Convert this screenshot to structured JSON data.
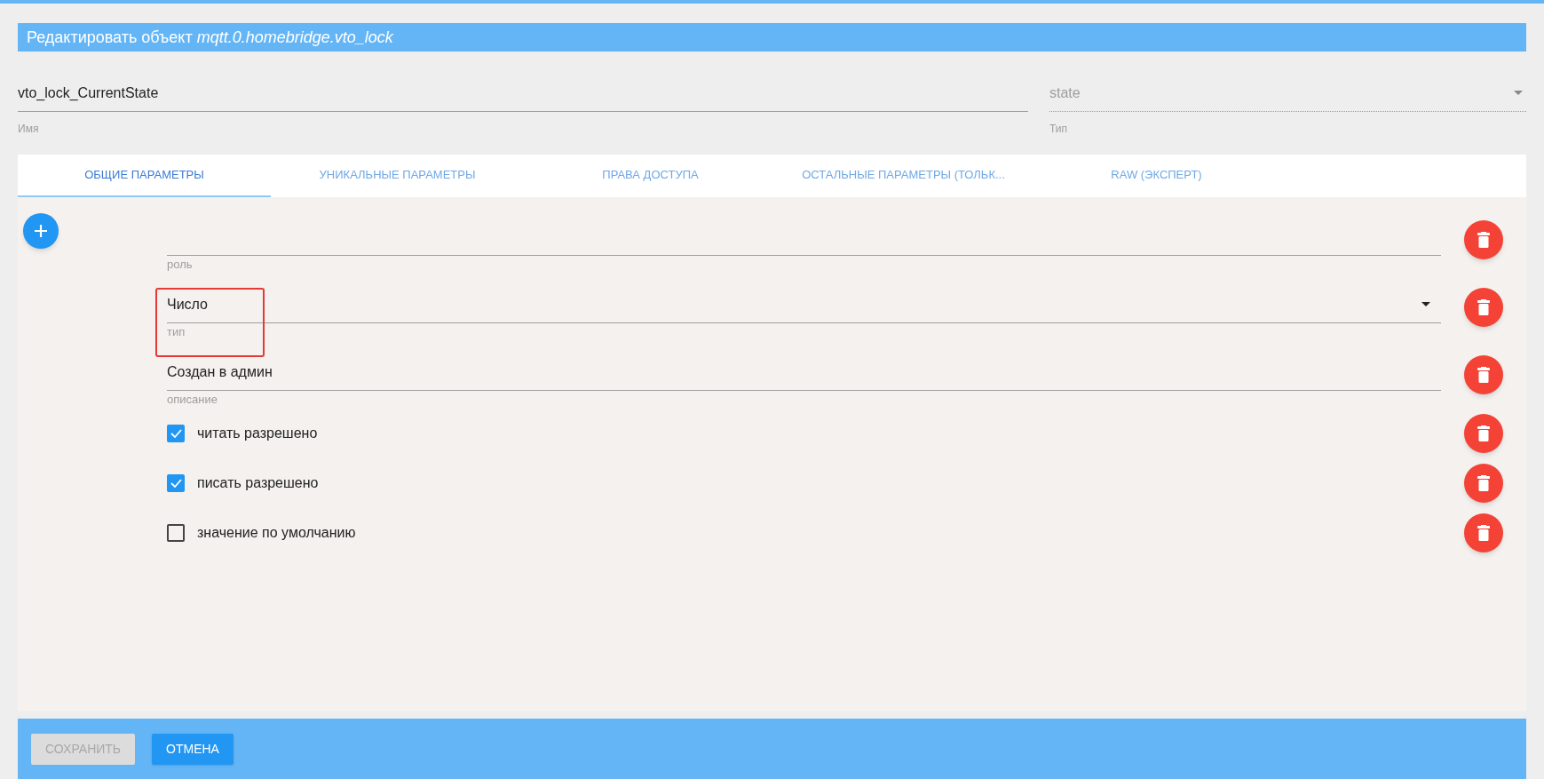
{
  "dialog": {
    "title": "Редактировать объект *mqtt.0.homebridge.vto_lock*"
  },
  "name_field": {
    "value": "vto_lock_CurrentState",
    "label": "Имя"
  },
  "type_field": {
    "value": "state",
    "label": "Тип",
    "disabled": true
  },
  "tabs": [
    {
      "label": "ОБЩИЕ ПАРАМЕТРЫ",
      "selected": true
    },
    {
      "label": "УНИКАЛЬНЫЕ ПАРАМЕТРЫ",
      "selected": false
    },
    {
      "label": "ПРАВА ДОСТУПА",
      "selected": false
    },
    {
      "label": "ОСТАЛЬНЫЕ ПАРАМЕТРЫ (ТОЛЬК...",
      "selected": false
    },
    {
      "label": "RAW (ЭКСПЕРТ)",
      "selected": false
    }
  ],
  "fields": [
    {
      "kind": "text",
      "label": "роль"
    },
    {
      "kind": "select",
      "value": "Число",
      "label": "тип",
      "highlighted": true
    },
    {
      "kind": "text",
      "value": "Создан в админ",
      "label": "описание"
    },
    {
      "kind": "checkbox",
      "label": "читать разрешено",
      "checked": true
    },
    {
      "kind": "checkbox",
      "label": "писать разрешено",
      "checked": true
    },
    {
      "kind": "checkbox",
      "label": "значение по умолчанию",
      "checked": false
    }
  ],
  "buttons": [
    {
      "label": "СОХРАНИТЬ",
      "disabled": true
    },
    {
      "label": "ОТМЕНА",
      "disabled": false
    }
  ]
}
